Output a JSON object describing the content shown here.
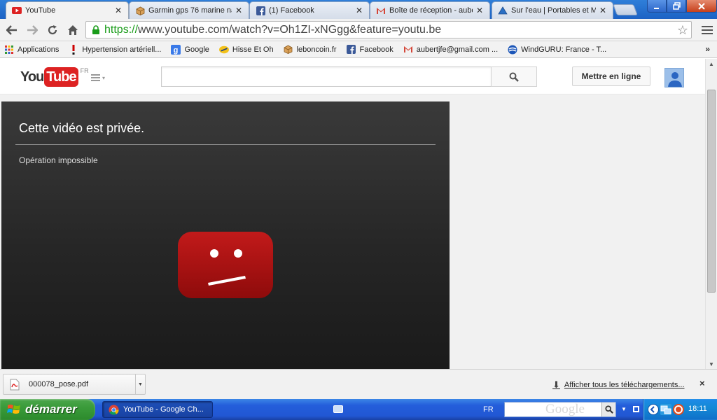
{
  "tabs": [
    {
      "title": "YouTube",
      "active": true,
      "icon": "youtube-icon"
    },
    {
      "title": "Garmin gps 76 marine na",
      "active": false,
      "icon": "box-icon"
    },
    {
      "title": "(1) Facebook",
      "active": false,
      "icon": "facebook-icon"
    },
    {
      "title": "Boîte de réception - aube",
      "active": false,
      "icon": "gmail-icon"
    },
    {
      "title": "Sur l'eau | Portables et M",
      "active": false,
      "icon": "triangle-icon"
    }
  ],
  "address": {
    "scheme": "https://",
    "rest": "www.youtube.com/watch?v=Oh1ZI-xNGgg&feature=youtu.be"
  },
  "bookmarks": [
    {
      "label": "Applications",
      "icon": "apps-grid-icon"
    },
    {
      "label": "Hypertension artériell...",
      "icon": "exclamation-icon"
    },
    {
      "label": "Google",
      "icon": "google-icon"
    },
    {
      "label": "Hisse Et Oh",
      "icon": "hisse-et-oh-icon"
    },
    {
      "label": "leboncoin.fr",
      "icon": "box-icon"
    },
    {
      "label": "Facebook",
      "icon": "facebook-icon"
    },
    {
      "label": "aubertjfe@gmail.com ...",
      "icon": "gmail-icon"
    },
    {
      "label": "WindGURU: France - T...",
      "icon": "windguru-icon"
    }
  ],
  "bookmarks_more": "»",
  "youtube": {
    "logo_you": "You",
    "logo_tube": "Tube",
    "region": "FR",
    "search_value": "",
    "upload_label": "Mettre en ligne"
  },
  "player": {
    "error_title": "Cette vidéo est privée.",
    "error_subtitle": "Opération impossible"
  },
  "downloads": {
    "file_name": "000078_pose.pdf",
    "show_all": "Afficher tous les téléchargements...",
    "close": "×"
  },
  "taskbar": {
    "start_label": "démarrer",
    "task_label": "YouTube - Google Ch...",
    "language": "FR",
    "google_logo": "Google",
    "time": "18:11"
  },
  "colors": {
    "youtube_red": "#cc1111",
    "url_secure_green": "#1a9c1a",
    "xp_blue": "#245edb",
    "xp_start_green": "#3a9b3a"
  }
}
